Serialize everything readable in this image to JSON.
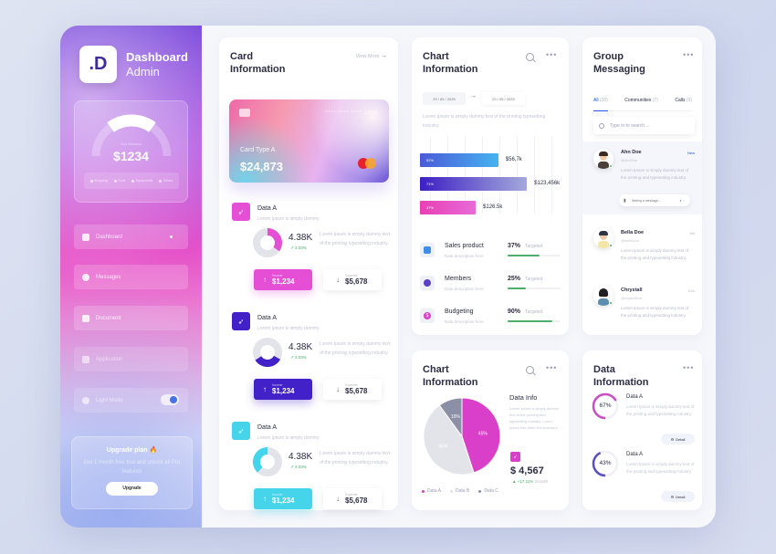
{
  "sidebar": {
    "logo": ".D",
    "brand_line1": "Dashboard",
    "brand_line2": "Admin",
    "balance": {
      "label": "Your Balance",
      "value": "$1234",
      "gauge_fraction": 0.4,
      "legend": [
        "Shopping",
        "Food",
        "Equipments",
        "Others"
      ]
    },
    "nav": [
      {
        "label": "Dashboard",
        "icon": "home-icon"
      },
      {
        "label": "Messages",
        "icon": "message-icon"
      },
      {
        "label": "Document",
        "icon": "document-icon"
      },
      {
        "label": "Application",
        "icon": "grid-icon"
      },
      {
        "label": "Light Mode",
        "icon": "contrast-icon"
      }
    ],
    "upgrade": {
      "title": "Upgrade plan 🔥",
      "desc": "Get 1 month free trial and unlock all Pro features",
      "button": "Upgrade"
    }
  },
  "card_info": {
    "title_line1": "Card",
    "title_line2": "Information",
    "view_more": "View More",
    "card": {
      "number": "**** **** **** 1234",
      "type": "Card Type A",
      "amount": "$24,873"
    },
    "blocks": [
      {
        "title": "Data A",
        "sub": "Lorem Ipsum is simply dummy",
        "value": "4.38K",
        "growth": "3.03%",
        "desc": "Lorem Ipsum is simply dummy text of the printing typesetting industry.",
        "income_label": "Income",
        "income": "$1,234",
        "expense_label": "Expense",
        "expense": "$5,678",
        "color": "#e44fd6",
        "donut_fraction": 0.35
      },
      {
        "title": "Data A",
        "sub": "Lorem Ipsum is simply dummy",
        "value": "4.38K",
        "growth": "3.03%",
        "desc": "Lorem Ipsum is simply dummy text of the printing typesetting industry.",
        "income_label": "Income",
        "income": "$1,234",
        "expense_label": "Expense",
        "expense": "$5,678",
        "color": "#4321c8",
        "donut_fraction": 0.33
      },
      {
        "title": "Data A",
        "sub": "Lorem Ipsum is simply dummy",
        "value": "4.38K",
        "growth": "3.03%",
        "desc": "Lorem Ipsum is simply dummy text of the printing typesetting industry.",
        "income_label": "Income",
        "income": "$1,234",
        "expense_label": "Expense",
        "expense": "$5,678",
        "color": "#45d4ea",
        "donut_fraction": 0.38
      }
    ]
  },
  "chart_info": {
    "title_line1": "Chart",
    "title_line2": "Information",
    "date_from": "20 / 05 / 2025",
    "date_to": "20 / 05 / 2025",
    "desc": "Lorem Ipsum is simply dummy text of the printing typesetting industry.",
    "bars": [
      {
        "pct": "52%",
        "value": "$56,7k",
        "fraction": 0.52
      },
      {
        "pct": "71%",
        "value": "$123,456k",
        "fraction": 0.71
      },
      {
        "pct": "37%",
        "value": "$126.5k",
        "fraction": 0.37
      }
    ],
    "progress": [
      {
        "title": "Sales product",
        "sub": "Data description here",
        "pct": "37%",
        "tag": "Targeted",
        "fraction": 0.6
      },
      {
        "title": "Members",
        "sub": "Data description here",
        "pct": "25%",
        "tag": "Targeted",
        "fraction": 0.35
      },
      {
        "title": "Budgeting",
        "sub": "Data description here",
        "pct": "90%",
        "tag": "Targeted",
        "fraction": 0.85
      }
    ]
  },
  "pie_card": {
    "title_line1": "Chart",
    "title_line2": "Information",
    "info_title": "Data Info",
    "info_desc": "Lorem Ipsum is simply dummy text of the printing and typesetting industry. Lorem Ipsum has been the industry's",
    "amount": "$ 4,567",
    "growth": "+17,11%",
    "growth_label": "Growth",
    "legend": [
      "Data A",
      "Data B",
      "Data C"
    ]
  },
  "chart_data": {
    "type": "pie",
    "title": "Chart Information",
    "categories": [
      "Data A",
      "Data B",
      "Data C"
    ],
    "values": [
      45,
      45,
      10
    ],
    "labels": [
      "45%",
      "45%",
      "10%"
    ],
    "colors": [
      "#d93fc8",
      "#e3e4ea",
      "#8b90a6"
    ],
    "legend_position": "bottom"
  },
  "messaging": {
    "title_line1": "Group",
    "title_line2": "Messaging",
    "tabs": [
      {
        "label": "All",
        "count": "(20)"
      },
      {
        "label": "Communities",
        "count": "(7)"
      },
      {
        "label": "Calls",
        "count": "(9)"
      }
    ],
    "search_placeholder": "Type in to search ...",
    "messages": [
      {
        "name": "Ahn Doe",
        "handle": "@ahnDoe",
        "time": "New",
        "text": "Lorem Ipsum is simply dummy text of the printing and typesetting industry.",
        "reply_placeholder": "Writing a message..."
      },
      {
        "name": "Bella Doe",
        "handle": "@bellaDoe",
        "time": "5m",
        "text": "Lorem Ipsum is simply dummy text of the printing and typesetting industry."
      },
      {
        "name": "Chrystall",
        "handle": "@crystalDoe",
        "time": "10m",
        "text": "Lorem Ipsum is simply dummy text of the printing and typesetting industry."
      }
    ]
  },
  "data_info": {
    "title_line1": "Data",
    "title_line2": "Information",
    "items": [
      {
        "pct": "67%",
        "fraction": 0.67,
        "title": "Data A",
        "text": "Lorem Ipsum is simply dummy text of the printing and typesetting industry.",
        "button": "Detail",
        "color": "#c94fc7"
      },
      {
        "pct": "43%",
        "fraction": 0.43,
        "title": "Data A",
        "text": "Lorem Ipsum is simply dummy text of the printing and typesetting industry.",
        "button": "Detail",
        "color": "#5a4ec4"
      }
    ]
  }
}
